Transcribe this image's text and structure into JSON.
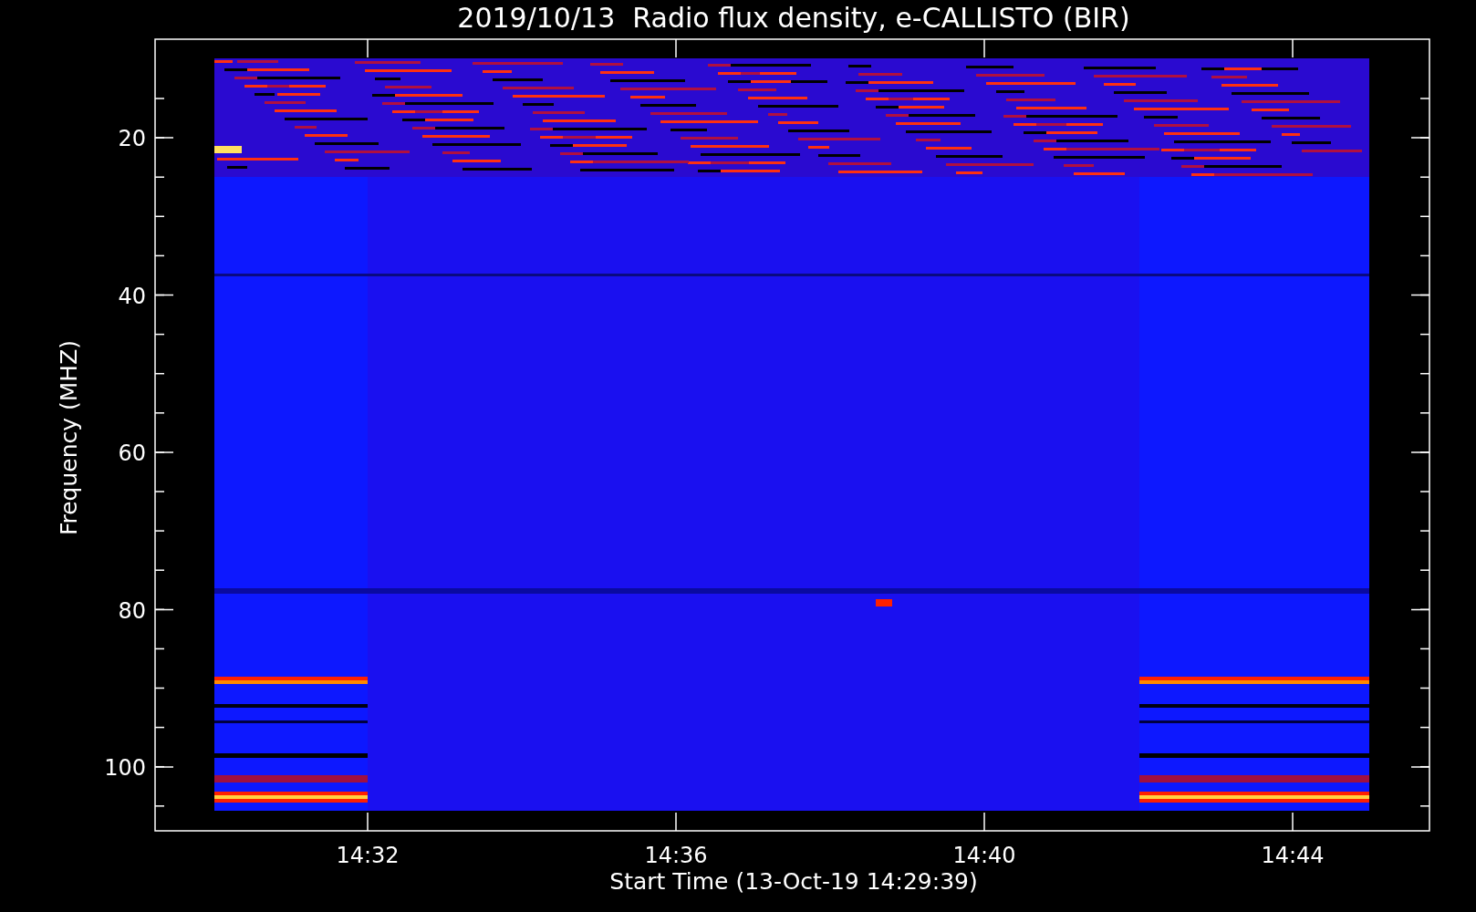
{
  "title": "2019/10/13  Radio flux density, e-CALLISTO (BIR)",
  "y_axis": {
    "label": "Frequency (MHZ)",
    "ticks": [
      "20",
      "40",
      "60",
      "80",
      "100"
    ]
  },
  "x_axis": {
    "label": "Start Time (13-Oct-19 14:29:39)",
    "ticks": [
      "14:32",
      "14:36",
      "14:40",
      "14:44"
    ]
  }
}
